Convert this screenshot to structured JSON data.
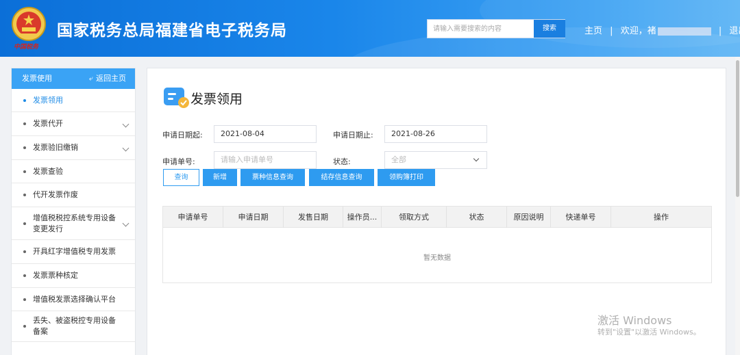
{
  "header": {
    "title": "国家税务总局福建省电子税务局",
    "emblem_caption": "中国税务",
    "search_placeholder": "请输入需要搜索的内容",
    "search_button": "搜索",
    "nav_home": "主页",
    "nav_sep1": "|",
    "welcome": "欢迎，",
    "user_initial": "褚",
    "nav_sep2": "|",
    "logout": "退出"
  },
  "sidebar": {
    "title": "发票使用",
    "back_label": "返回主页",
    "items": [
      {
        "label": "发票领用",
        "active": true,
        "expandable": false
      },
      {
        "label": "发票代开",
        "active": false,
        "expandable": true
      },
      {
        "label": "发票验旧缴销",
        "active": false,
        "expandable": true
      },
      {
        "label": "发票查验",
        "active": false,
        "expandable": false
      },
      {
        "label": "代开发票作废",
        "active": false,
        "expandable": false
      },
      {
        "label": "增值税税控系统专用设备变更发行",
        "active": false,
        "expandable": true
      },
      {
        "label": "开具红字增值税专用发票",
        "active": false,
        "expandable": false
      },
      {
        "label": "发票票种核定",
        "active": false,
        "expandable": false
      },
      {
        "label": "增值税发票选择确认平台",
        "active": false,
        "expandable": false
      },
      {
        "label": "丢失、被盗税控专用设备备案",
        "active": false,
        "expandable": false
      }
    ]
  },
  "main": {
    "title": "发票领用",
    "form": {
      "start_date_label": "申请日期起:",
      "start_date_value": "2021-08-04",
      "end_date_label": "申请日期止:",
      "end_date_value": "2021-08-26",
      "order_no_label": "申请单号:",
      "order_no_placeholder": "请输入申请单号",
      "status_label": "状态:",
      "status_value": "全部"
    },
    "buttons": {
      "query": "查询",
      "add": "新增",
      "type_query": "票种信息查询",
      "stock_query": "结存信息查询",
      "print": "领购簿打印"
    },
    "table": {
      "columns": [
        "申请单号",
        "申请日期",
        "发售日期",
        "操作员...",
        "领取方式",
        "状态",
        "原因说明",
        "快递单号",
        "操作"
      ],
      "empty_text": "暂无数据"
    }
  },
  "watermark": {
    "line1": "激活 Windows",
    "line2": "转到\"设置\"以激活 Windows。"
  },
  "colors": {
    "header_blue": "#1a86ea",
    "accent": "#2e9bf0",
    "sidebar_head": "#3aa3f5",
    "active_item": "#1e8be6"
  }
}
